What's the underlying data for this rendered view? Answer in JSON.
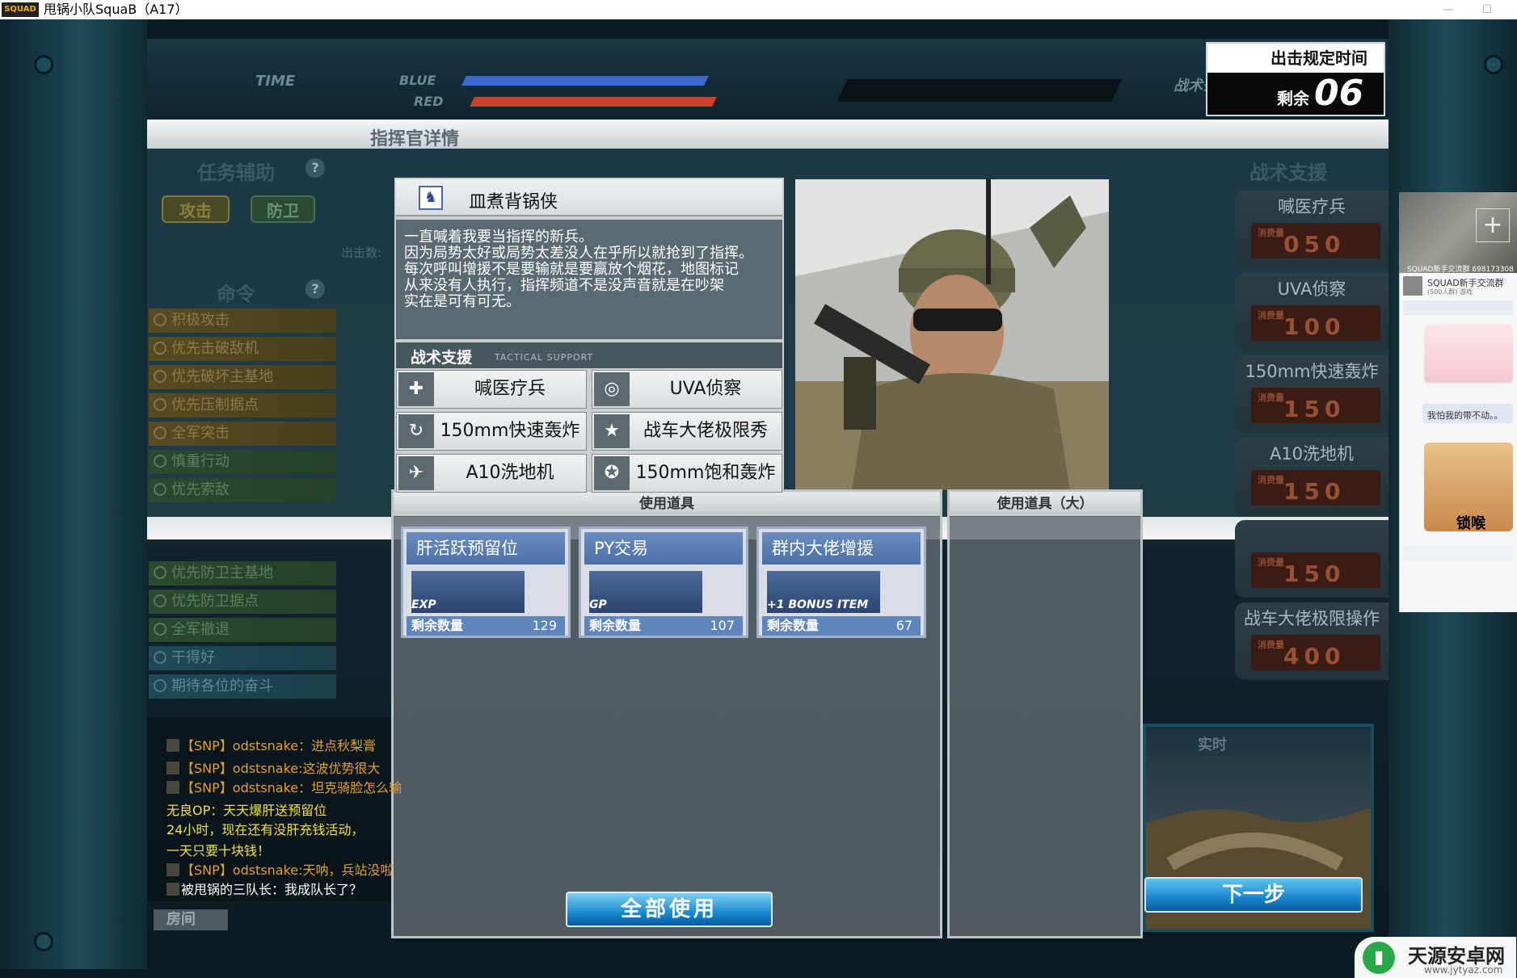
{
  "window": {
    "title": "甩锅小队SquaB（A17）",
    "logo_text": "SQUAD"
  },
  "hud": {
    "time_label": "TIME",
    "blue_label": "BLUE",
    "red_label": "RED",
    "tactics_label": "战术条"
  },
  "deadline": {
    "label": "出击规定时间",
    "remain_label": "剩余",
    "remain_value": "06"
  },
  "dialog": {
    "title": "指挥官详情"
  },
  "left_panel": {
    "assist_title": "任务辅助",
    "attack_label": "攻击",
    "defense_label": "防卫",
    "command_title": "命令",
    "sortie_label": "出击数:",
    "commands": [
      {
        "label": "积极攻击",
        "kind": "red"
      },
      {
        "label": "优先击破敌机",
        "kind": "red"
      },
      {
        "label": "优先破坏主基地",
        "kind": "red"
      },
      {
        "label": "优先压制据点",
        "kind": "red"
      },
      {
        "label": "全军突击",
        "kind": "red"
      },
      {
        "label": "慎重行动",
        "kind": "grn"
      },
      {
        "label": "优先索敌",
        "kind": "grn"
      }
    ],
    "commands_lower": [
      {
        "label": "优先防卫主基地",
        "kind": "grn"
      },
      {
        "label": "优先防卫据点",
        "kind": "grn"
      },
      {
        "label": "全军撤退",
        "kind": "grn"
      },
      {
        "label": "干得好",
        "kind": "blu"
      },
      {
        "label": "期待各位的奋斗",
        "kind": "blu"
      }
    ]
  },
  "right_panel": {
    "title": "战术支援",
    "cost_label": "消费量",
    "items": [
      {
        "name": "喊医疗兵",
        "cost": "050"
      },
      {
        "name": "UVA侦察",
        "cost": "100"
      },
      {
        "name": "150mm快速轰炸",
        "cost": "150"
      },
      {
        "name": "A10洗地机",
        "cost": "150"
      },
      {
        "name": "",
        "cost": "150"
      },
      {
        "name": "战车大佬极限操作",
        "cost": "400"
      }
    ]
  },
  "commander": {
    "name": "皿煮背锅侠",
    "description": [
      "一直喊着我要当指挥的新兵。",
      "因为局势太好或局势太差没人在乎所以就抢到了指挥。",
      "每次呼叫增援不是要输就是要赢放个烟花，地图标记",
      "从来没有人执行，指挥频道不是没声音就是在吵架",
      "实在是可有可无。"
    ],
    "support_title": "战术支援",
    "support_subtitle": "TACTICAL SUPPORT",
    "support": [
      {
        "label": "喊医疗兵",
        "icon": "medic-icon"
      },
      {
        "label": "UVA侦察",
        "icon": "radar-icon"
      },
      {
        "label": "150mm快速轰炸",
        "icon": "artillery-icon"
      },
      {
        "label": "战车大佬极限秀",
        "icon": "star-icon"
      },
      {
        "label": "A10洗地机",
        "icon": "aircraft-icon"
      },
      {
        "label": "150mm饱和轰炸",
        "icon": "barrage-icon"
      }
    ]
  },
  "items_panel": {
    "title": "使用道具",
    "title_large": "使用道具（大）",
    "remain_label": "剩余数量",
    "use_all_label": "全部使用",
    "items": [
      {
        "name": "肝活跃预留位",
        "tag": "EXP",
        "count": "129",
        "icon": "exp-boost-icon"
      },
      {
        "name": "PY交易",
        "tag": "GP",
        "count": "107",
        "icon": "gp-boost-icon"
      },
      {
        "name": "群内大佬增援",
        "tag": "+1 BONUS ITEM",
        "count": "67",
        "icon": "bonus-item-icon"
      }
    ]
  },
  "chat": {
    "room_tab": "房间",
    "messages": [
      {
        "text": "【SNP】odstsnake：进点秋梨膏",
        "color": "#e0a030",
        "badge": true
      },
      {
        "text": "【SNP】odstsnake:这波优势很大",
        "color": "#e0a030",
        "badge": true
      },
      {
        "text": "【SNP】odstsnake：坦克骑脸怎么输",
        "color": "#e0a030",
        "badge": true
      },
      {
        "text": "无良OP：天天爆肝送预留位",
        "color": "#f2e040",
        "badge": false
      },
      {
        "text": "24小时，现在还有没肝充钱活动，",
        "color": "#f2e040",
        "badge": false
      },
      {
        "text": "一天只要十块钱！",
        "color": "#f2e040",
        "badge": false
      },
      {
        "text": "【SNP】odstsnake:天呐，兵站没啦",
        "color": "#e0a030",
        "badge": true
      },
      {
        "text": "被甩锅的三队长：我成队长了？",
        "color": "#ffffff",
        "badge": true
      }
    ]
  },
  "minimap": {
    "label": "实时"
  },
  "next_button": {
    "label": "下一步"
  },
  "qq_overlay": {
    "group_id": "SQUAD新手交流群 698173308",
    "group_name": "SQUAD新手交流群",
    "group_members": "(500人群) 游戏",
    "msg1": "我怕我的带不动。。",
    "sticker_text": "锁喉"
  },
  "watermark": {
    "name": "天源安卓网",
    "url": "www.jytyaz.com"
  }
}
